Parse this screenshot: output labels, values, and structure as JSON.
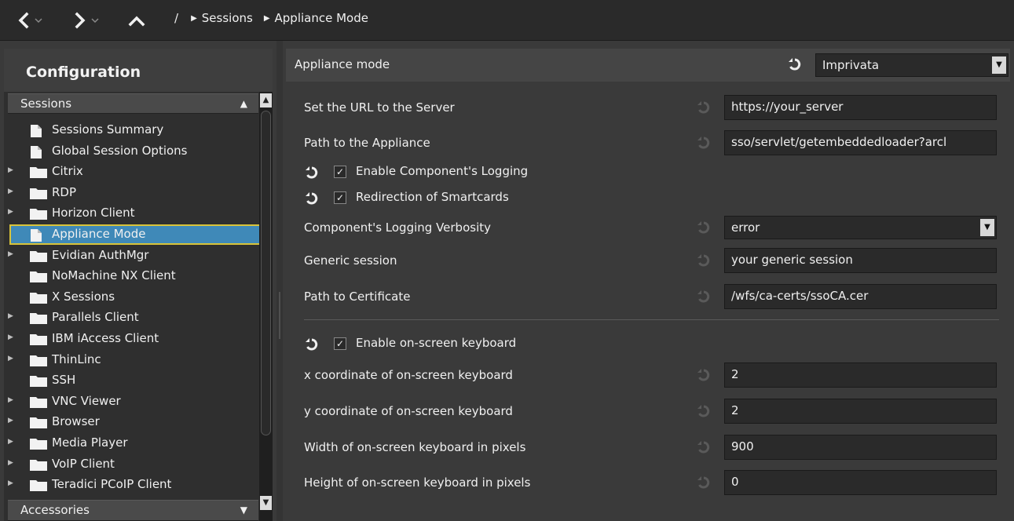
{
  "toolbar": {
    "root_sep": "/",
    "breadcrumbs": [
      "Sessions",
      "Appliance Mode"
    ]
  },
  "sidebar": {
    "title": "Configuration",
    "section_top": "Sessions",
    "section_bottom": "Accessories",
    "items": [
      {
        "label": "Sessions Summary",
        "icon": "document-icon",
        "expandable": false
      },
      {
        "label": "Global Session Options",
        "icon": "document-icon",
        "expandable": false
      },
      {
        "label": "Citrix",
        "icon": "folder-icon",
        "expandable": true
      },
      {
        "label": "RDP",
        "icon": "folder-icon",
        "expandable": true
      },
      {
        "label": "Horizon Client",
        "icon": "folder-icon",
        "expandable": true
      },
      {
        "label": "Appliance Mode",
        "icon": "document-icon",
        "expandable": false,
        "selected": true
      },
      {
        "label": "Evidian AuthMgr",
        "icon": "folder-icon",
        "expandable": true
      },
      {
        "label": "NoMachine NX Client",
        "icon": "folder-icon",
        "expandable": false
      },
      {
        "label": "X Sessions",
        "icon": "folder-icon",
        "expandable": false
      },
      {
        "label": "Parallels Client",
        "icon": "folder-icon",
        "expandable": true
      },
      {
        "label": "IBM iAccess Client",
        "icon": "folder-icon",
        "expandable": true
      },
      {
        "label": "ThinLinc",
        "icon": "folder-icon",
        "expandable": true
      },
      {
        "label": "SSH",
        "icon": "folder-icon",
        "expandable": false
      },
      {
        "label": "VNC Viewer",
        "icon": "folder-icon",
        "expandable": true
      },
      {
        "label": "Browser",
        "icon": "folder-icon",
        "expandable": true
      },
      {
        "label": "Media Player",
        "icon": "folder-icon",
        "expandable": true
      },
      {
        "label": "VoIP Client",
        "icon": "folder-icon",
        "expandable": true
      },
      {
        "label": "Teradici PCoIP Client",
        "icon": "folder-icon",
        "expandable": true
      }
    ]
  },
  "main": {
    "header": {
      "title": "Appliance mode",
      "mode_value": "Imprivata"
    },
    "fields": {
      "server_url": {
        "label": "Set the URL to the Server",
        "value": "https://your_server"
      },
      "appliance_path": {
        "label": "Path to the Appliance",
        "value": "sso/servlet/getembeddedloader?arcl"
      },
      "logging_verbosity": {
        "label": "Component's Logging Verbosity",
        "value": "error"
      },
      "generic_session": {
        "label": "Generic session",
        "value": "your generic session"
      },
      "cert_path": {
        "label": "Path to Certificate",
        "value": "/wfs/ca-certs/ssoCA.cer"
      },
      "kbd_x": {
        "label": "x coordinate of on-screen keyboard",
        "value": "2"
      },
      "kbd_y": {
        "label": "y coordinate of on-screen keyboard",
        "value": "2"
      },
      "kbd_width": {
        "label": "Width of on-screen keyboard in pixels",
        "value": "900"
      },
      "kbd_height": {
        "label": "Height of on-screen keyboard in pixels",
        "value": "0"
      }
    },
    "checkboxes": {
      "enable_logging": {
        "label": "Enable Component's Logging",
        "checked": true
      },
      "redirect_smartcards": {
        "label": "Redirection of Smartcards",
        "checked": true
      },
      "enable_osk": {
        "label": "Enable on-screen keyboard",
        "checked": true
      }
    },
    "check_glyph": "✓"
  },
  "colors": {
    "selection": "#3f89b8",
    "selection_outline": "#d8c33a",
    "panel": "#3a3a3a",
    "field": "#2a2a2a"
  }
}
